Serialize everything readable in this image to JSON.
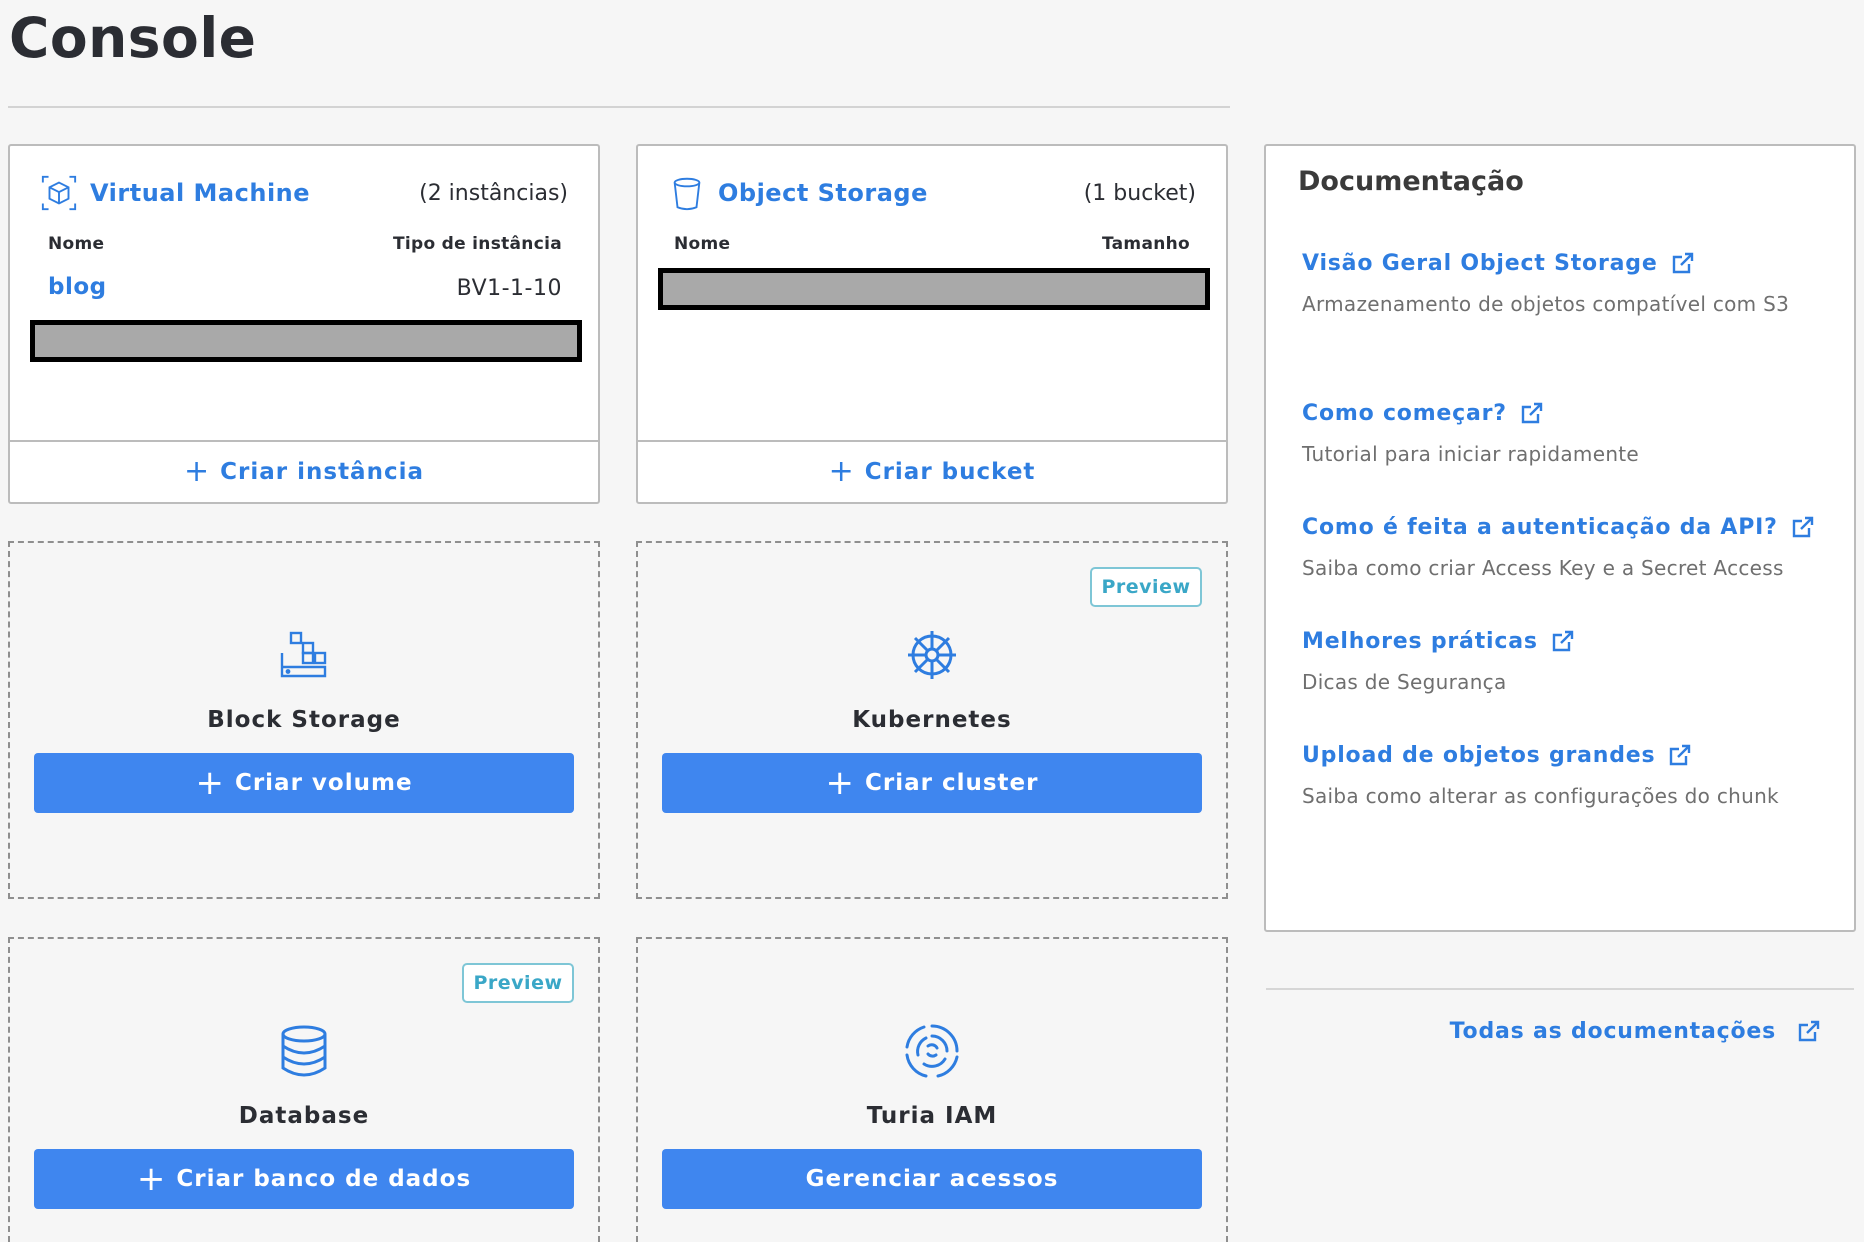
{
  "page": {
    "title": "Console"
  },
  "colors": {
    "accent": "#2e7de0",
    "button": "#3f86ef",
    "preview": "#3aa7c7"
  },
  "vm_card": {
    "icon": "cube-icon",
    "name": "Virtual Machine",
    "count": "(2 instâncias)",
    "col_name": "Nome",
    "col_type": "Tipo de instância",
    "rows": [
      {
        "name": "blog",
        "type": "BV1-1-10"
      }
    ],
    "action": "Criar instância"
  },
  "storage_card": {
    "icon": "bucket-icon",
    "name": "Object Storage",
    "count": "(1 bucket)",
    "col_name": "Nome",
    "col_size": "Tamanho",
    "action": "Criar bucket"
  },
  "services": {
    "block_storage": {
      "icon": "block-storage-icon",
      "label": "Block Storage",
      "button": "Criar volume"
    },
    "kubernetes": {
      "icon": "kubernetes-icon",
      "label": "Kubernetes",
      "button": "Criar cluster",
      "badge": "Preview"
    },
    "database": {
      "icon": "database-icon",
      "label": "Database",
      "button": "Criar banco de dados",
      "badge": "Preview"
    },
    "iam": {
      "icon": "iam-icon",
      "label": "Turia IAM",
      "button": "Gerenciar acessos"
    }
  },
  "docs": {
    "title": "Documentação",
    "items": [
      {
        "link": "Visão Geral Object Storage",
        "desc": "Armazenamento de objetos compatível com S3"
      },
      {
        "link": "Como começar?",
        "desc": "Tutorial para iniciar rapidamente"
      },
      {
        "link": "Como é feita a autenticação da API?",
        "desc": "Saiba como criar Access Key e a Secret Access"
      },
      {
        "link": "Melhores práticas",
        "desc": "Dicas de Segurança"
      },
      {
        "link": "Upload de objetos grandes",
        "desc": "Saiba como alterar as configurações do chunk"
      }
    ],
    "all_link": "Todas as documentações"
  }
}
